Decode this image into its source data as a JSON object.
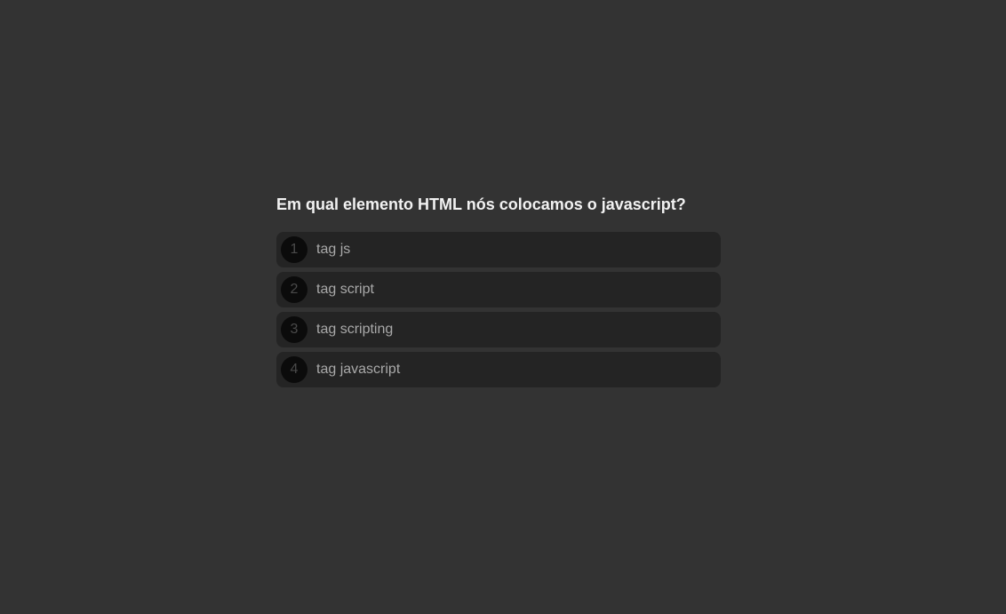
{
  "quiz": {
    "question": "Em qual elemento HTML nós colocamos o javascript?",
    "options": [
      {
        "number": "1",
        "label": "tag js"
      },
      {
        "number": "2",
        "label": "tag script"
      },
      {
        "number": "3",
        "label": "tag scripting"
      },
      {
        "number": "4",
        "label": "tag javascript"
      }
    ]
  },
  "colors": {
    "background": "#333333",
    "option_background": "#242424",
    "number_badge": "#0b0b0b",
    "question_text": "#f2f2f2",
    "option_text": "#a9a9a9"
  }
}
